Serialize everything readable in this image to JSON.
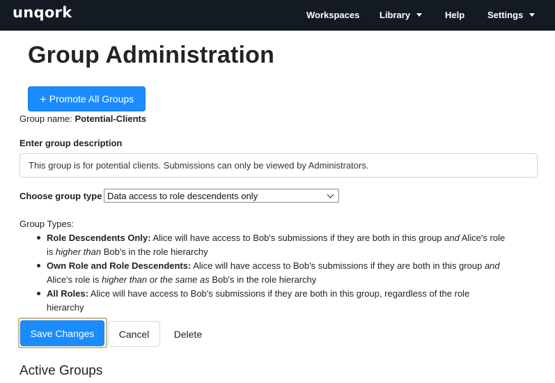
{
  "navbar": {
    "logo": "unqork",
    "items": [
      {
        "label": "Workspaces",
        "has_dropdown": false
      },
      {
        "label": "Library",
        "has_dropdown": true
      },
      {
        "label": "Help",
        "has_dropdown": false
      },
      {
        "label": "Settings",
        "has_dropdown": true
      }
    ],
    "background": "#141a24"
  },
  "page": {
    "title": "Group Administration",
    "promote_button": {
      "icon": "plus-icon",
      "label": "Promote All Groups"
    },
    "group_name": {
      "label": "Group name:",
      "value": "Potential-Clients"
    },
    "description": {
      "label": "Enter group description",
      "value": "This group is for potential clients. Submissions can only be viewed by Administrators."
    },
    "group_type": {
      "label": "Choose group type",
      "selected": "Data access to role descendents only"
    },
    "group_types_help": {
      "heading": "Group Types:",
      "items": [
        {
          "title": "Role Descendents Only:",
          "line1_a": "Alice will have access to Bob's submissions if they are both in this group",
          "line1_em": "and",
          "line1_b": "Alice's role",
          "line2_a": "is",
          "line2_em": "higher than",
          "line2_b": "Bob's in the role hierarchy"
        },
        {
          "title": "Own Role and Role Descendents:",
          "line1_a": "Alice will have access to Bob's submissions if they are both in this group",
          "line1_em": "and",
          "line2_a": "Alice's role is",
          "line2_em": "higher than or the same as",
          "line2_b": "Bob's in the role hierarchy"
        },
        {
          "title": "All Roles:",
          "line1_a": "Alice will have access to Bob's submissions if they are both in this group, regardless of the role",
          "line2_a": "hierarchy"
        }
      ]
    },
    "actions": {
      "save": "Save Changes",
      "cancel": "Cancel",
      "delete": "Delete"
    },
    "active_groups_title": "Active Groups"
  },
  "colors": {
    "primary": "#1a8cff",
    "navbar": "#141a24",
    "focus_outline": "#c8b98a"
  }
}
